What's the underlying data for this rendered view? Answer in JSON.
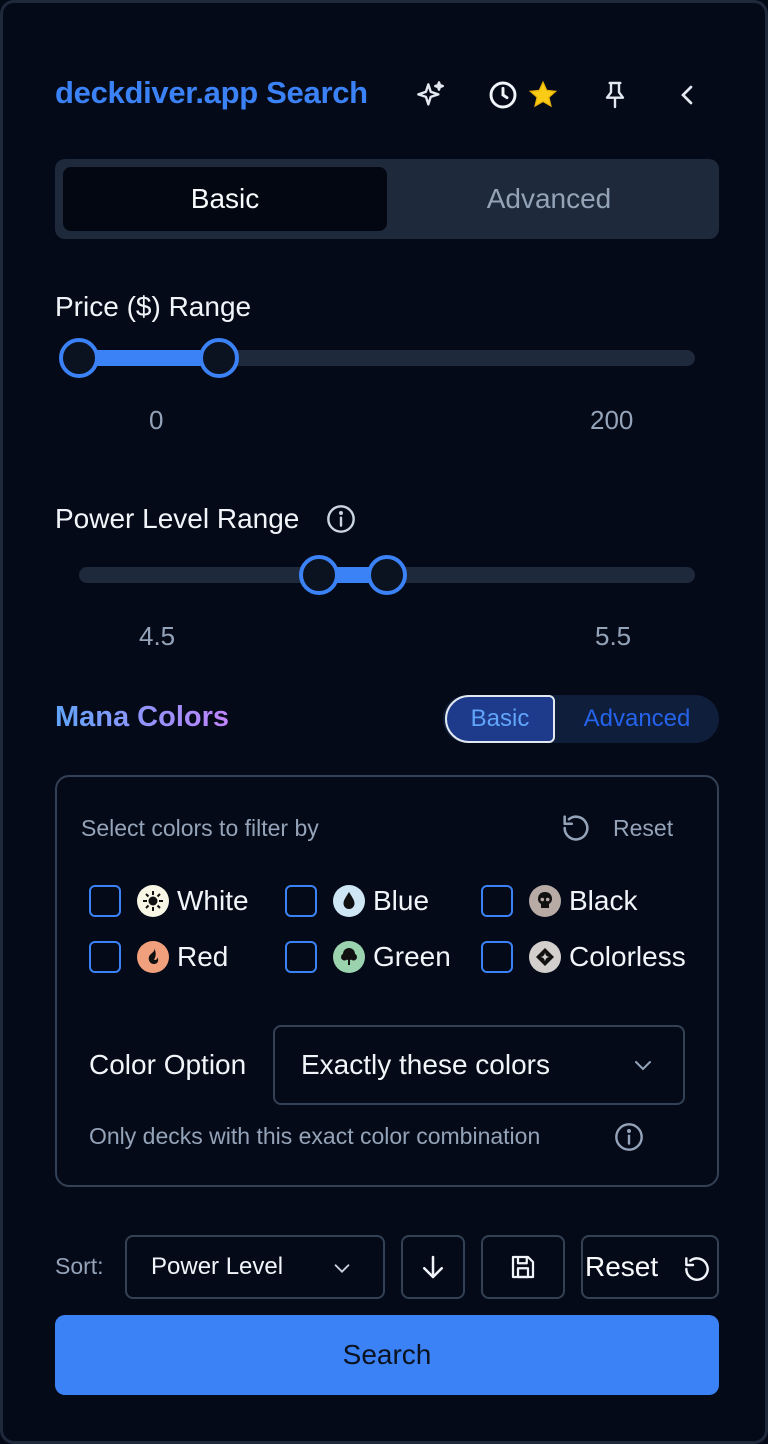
{
  "header": {
    "title": "deckdiver.app Search",
    "icons": [
      "sparkles-icon",
      "clock-icon",
      "star-icon",
      "pin-icon",
      "chevron-left-icon"
    ]
  },
  "tabs": [
    {
      "label": "Basic",
      "active": true
    },
    {
      "label": "Advanced",
      "active": false
    }
  ],
  "price_range": {
    "label": "Price ($) Range",
    "min_label": "0",
    "max_label": "200",
    "selected_fraction": [
      0.0,
      0.23
    ]
  },
  "power_range": {
    "label": "Power Level Range",
    "min_label": "4.5",
    "max_label": "5.5",
    "selected_fraction": [
      0.39,
      0.5
    ]
  },
  "mana": {
    "title": "Mana Colors",
    "mode_basic": "Basic",
    "mode_advanced": "Advanced",
    "hint": "Select colors to filter by",
    "reset_label": "Reset",
    "colors": [
      {
        "label": "White",
        "icon": "white-mana-icon",
        "checked": false
      },
      {
        "label": "Blue",
        "icon": "blue-mana-icon",
        "checked": false
      },
      {
        "label": "Black",
        "icon": "black-mana-icon",
        "checked": false
      },
      {
        "label": "Red",
        "icon": "red-mana-icon",
        "checked": false
      },
      {
        "label": "Green",
        "icon": "green-mana-icon",
        "checked": false
      },
      {
        "label": "Colorless",
        "icon": "colorless-mana-icon",
        "checked": false
      }
    ],
    "color_option_label": "Color Option",
    "color_option_value": "Exactly these colors",
    "color_option_help": "Only decks with this exact color combination"
  },
  "sort": {
    "label": "Sort:",
    "value": "Power Level",
    "reset_label": "Reset"
  },
  "search_label": "Search",
  "colors": {
    "accent": "#3b82f6",
    "background": "#050a18",
    "star": "#facc15"
  }
}
